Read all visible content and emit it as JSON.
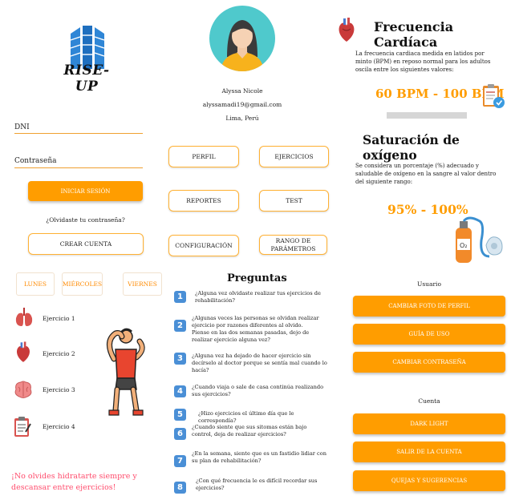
{
  "login": {
    "logo_text": "RISE-UP",
    "dni_label": "DNI",
    "password_label": "Contraseña",
    "login_button": "INICIAR SESIÓN",
    "forgot_link": "¿Olvidaste tu contraseña?",
    "create_account_button": "CREAR CUENTA"
  },
  "profile": {
    "name": "Alyssa Nicole",
    "email": "alyssamadi19@gmail.com",
    "location": "Lima, Perú",
    "menu": [
      "PERFIL",
      "EJERCICIOS",
      "REPORTES",
      "TEST",
      "CONFIGURACIÓN",
      "RANGO DE PARÁMETROS"
    ]
  },
  "heart": {
    "title": "Frecuencia Cardíaca",
    "description": "La frecuencia cardiaca medida en latidos por minto (BPM) en reposo normal para los adultos oscila entre los siguientes valores:",
    "range": "60 BPM - 100 BPM"
  },
  "oxygen": {
    "title": "Saturación de oxígeno",
    "description": "Se considera un porcentaje (%)  adecuado y saludable de oxígeno en la sangre al valor dentro del siguiente rango:",
    "range": "95% - 100%"
  },
  "exercises": {
    "days": [
      "LUNES",
      "MIÉRCOLES",
      "VIERNES"
    ],
    "items": [
      {
        "label": "Ejercicio 1",
        "icon": "lungs-icon"
      },
      {
        "label": "Ejercicio 2",
        "icon": "heart-icon"
      },
      {
        "label": "Ejercicio 3",
        "icon": "brain-icon"
      },
      {
        "label": "Ejercicio 4",
        "icon": "clipboard-icon"
      }
    ],
    "reminder": "¡No olvides hidratarte siempre y descansar entre ejercicios!"
  },
  "questions": {
    "title": "Preguntas",
    "items": [
      "¿Alguna vez olvidaste realizar tus ejercicios de rehabilitación?",
      "¿Algunas veces las personas se olvidan realizar ejercicio por razones diferentes al olvido. Piense en las dos semanas pasadas, dejo de realizar ejercicio alguna vez?",
      "¿Alguna vez ha dejado de hacer ejercicio sin decírselo al doctor porque se sentía mal cuando lo hacía?",
      "¿Cuando viaja o sale de casa continúa realizando sus ejercicios?",
      "¿Hizo ejercicios el último día que le correspondía?",
      "¿Cuando siente que sus sitomas están bajo control, deja de realizar ejercicios?",
      "¿En la semana, siente que es un fastidio lidiar con su plan de rehabilitación?",
      "¿Con qué frecuencia le es difícil recordar sus ejercicios?"
    ]
  },
  "settings": {
    "user_heading": "Usuario",
    "user_buttons": [
      "CAMBIAR FOTO DE PERFIL",
      "GUÍA DE USO",
      "CAMBIAR CONTRASEÑA"
    ],
    "account_heading": "Cuenta",
    "account_buttons": [
      "DARK LIGHT",
      "SALIR DE LA CUENTA",
      "QUEJAS Y SUGERENCIAS"
    ]
  },
  "colors": {
    "accent": "#ff9d00",
    "outline": "#ffb133",
    "question_number": "#4a8fd6",
    "reminder_text": "#ff4d6d"
  }
}
